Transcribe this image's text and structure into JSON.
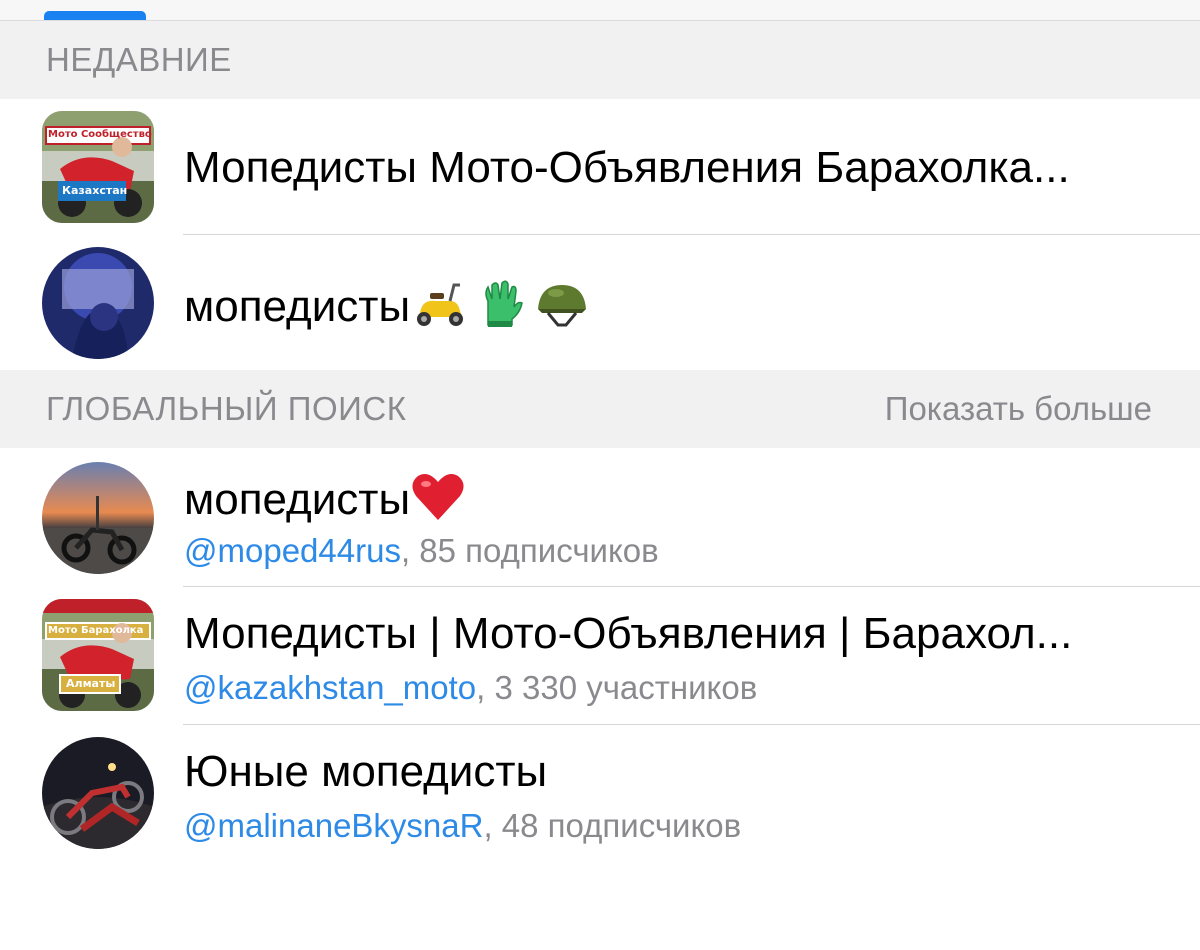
{
  "sections": {
    "recent_title": "НЕДАВНИЕ",
    "global_title": "ГЛОБАЛЬНЫЙ ПОИСК",
    "show_more": "Показать больше"
  },
  "recent": [
    {
      "title": "Мопедисты Мото-Объявления Барахолка...",
      "avatar_top_text": "Мото Сообщество",
      "avatar_bottom_text": "Казахстан"
    },
    {
      "title": "мопедисты",
      "emojis": [
        "scooter-emoji",
        "glove-emoji",
        "helmet-emoji"
      ]
    }
  ],
  "global": [
    {
      "title": "мопедисты",
      "emoji": "red-heart-emoji",
      "handle": "@moped44rus",
      "meta": ", 85 подписчиков"
    },
    {
      "title": "Мопедисты | Мото-Объявления | Барахол...",
      "handle": "@kazakhstan_moto",
      "meta": ", 3 330 участников",
      "avatar_top_text": "Мото Барахолка",
      "avatar_bottom_text": "Алматы"
    },
    {
      "title": "Юные мопедисты",
      "handle": "@malinaneBkysnaR",
      "meta": ", 48 подписчиков"
    }
  ],
  "colors": {
    "accent": "#1a82f0",
    "link": "#2d8ae6",
    "secondary_text": "#8a8a8e",
    "header_bg": "#f1f1f2"
  }
}
